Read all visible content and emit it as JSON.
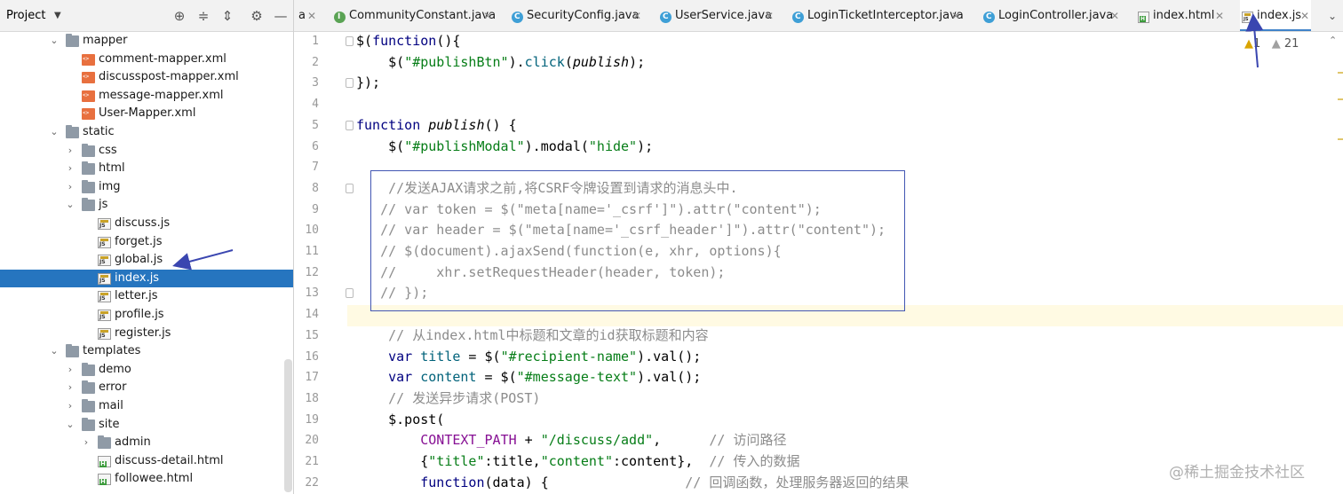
{
  "project_panel": {
    "title": "Project",
    "dropdown_icon": "chevron-down-icon",
    "toolbar_icons": [
      "locate-icon",
      "expand-all-icon",
      "collapse-all-icon",
      "gear-icon",
      "minimize-icon"
    ],
    "tree": [
      {
        "label": "mapper",
        "type": "folder",
        "depth": 0,
        "expanded": true
      },
      {
        "label": "comment-mapper.xml",
        "type": "xml",
        "depth": 1
      },
      {
        "label": "discusspost-mapper.xml",
        "type": "xml",
        "depth": 1
      },
      {
        "label": "message-mapper.xml",
        "type": "xml",
        "depth": 1
      },
      {
        "label": "User-Mapper.xml",
        "type": "xml",
        "depth": 1
      },
      {
        "label": "static",
        "type": "folder",
        "depth": 0,
        "expanded": true
      },
      {
        "label": "css",
        "type": "folder",
        "depth": 1,
        "expanded": false
      },
      {
        "label": "html",
        "type": "folder",
        "depth": 1,
        "expanded": false
      },
      {
        "label": "img",
        "type": "folder",
        "depth": 1,
        "expanded": false
      },
      {
        "label": "js",
        "type": "folder",
        "depth": 1,
        "expanded": true
      },
      {
        "label": "discuss.js",
        "type": "js",
        "depth": 2
      },
      {
        "label": "forget.js",
        "type": "js",
        "depth": 2
      },
      {
        "label": "global.js",
        "type": "js",
        "depth": 2
      },
      {
        "label": "index.js",
        "type": "js",
        "depth": 2,
        "selected": true
      },
      {
        "label": "letter.js",
        "type": "js",
        "depth": 2
      },
      {
        "label": "profile.js",
        "type": "js",
        "depth": 2
      },
      {
        "label": "register.js",
        "type": "js",
        "depth": 2
      },
      {
        "label": "templates",
        "type": "folder",
        "depth": 0,
        "expanded": true
      },
      {
        "label": "demo",
        "type": "folder",
        "depth": 1,
        "expanded": false
      },
      {
        "label": "error",
        "type": "folder",
        "depth": 1,
        "expanded": false
      },
      {
        "label": "mail",
        "type": "folder",
        "depth": 1,
        "expanded": false
      },
      {
        "label": "site",
        "type": "folder",
        "depth": 1,
        "expanded": true
      },
      {
        "label": "admin",
        "type": "folder",
        "depth": 2,
        "expanded": false
      },
      {
        "label": "discuss-detail.html",
        "type": "html",
        "depth": 2
      },
      {
        "label": "followee.html",
        "type": "html",
        "depth": 2
      }
    ]
  },
  "tabs": [
    {
      "label": "a",
      "icon": "none",
      "active": false
    },
    {
      "label": "CommunityConstant.java",
      "icon": "interface",
      "active": false
    },
    {
      "label": "SecurityConfig.java",
      "icon": "class",
      "active": false
    },
    {
      "label": "UserService.java",
      "icon": "class",
      "active": false
    },
    {
      "label": "LoginTicketInterceptor.java",
      "icon": "class",
      "active": false
    },
    {
      "label": "LoginController.java",
      "icon": "class",
      "active": false
    },
    {
      "label": "index.html",
      "icon": "html",
      "active": false
    },
    {
      "label": "index.js",
      "icon": "js",
      "active": true
    }
  ],
  "tab_close_icon": "close-icon",
  "tab_menu_icon": "chevron-down-icon",
  "inspection": {
    "warnings_a": "1",
    "warnings_b": "21"
  },
  "editor": {
    "current_line": 14,
    "lines": [
      {
        "n": 1,
        "html": "$(<span class='kw'>function</span>(){"
      },
      {
        "n": 2,
        "html": "    $(<span class='str'>\"#publishBtn\"</span>).<span class='fn'>click</span>(<span class='it'>publish</span>);"
      },
      {
        "n": 3,
        "html": "});"
      },
      {
        "n": 4,
        "html": ""
      },
      {
        "n": 5,
        "html": "<span class='kw'>function</span> <span class='it'>publish</span>() {"
      },
      {
        "n": 6,
        "html": "    $(<span class='str'>\"#publishModal\"</span>).modal(<span class='str'>\"hide\"</span>);"
      },
      {
        "n": 7,
        "html": ""
      },
      {
        "n": 8,
        "html": "<span class='gray'>    //发送AJAX请求之前,将CSRF令牌设置到请求的消息头中.</span>"
      },
      {
        "n": 9,
        "html": "<span class='gray'>   // var token = $(\"meta[name='_csrf']\").attr(\"content\");</span>"
      },
      {
        "n": 10,
        "html": "<span class='gray'>   // var header = $(\"meta[name='_csrf_header']\").attr(\"content\");</span>"
      },
      {
        "n": 11,
        "html": "<span class='gray'>   // $(document).ajaxSend(function(e, xhr, options){</span>"
      },
      {
        "n": 12,
        "html": "<span class='gray'>   //     xhr.setRequestHeader(header, token);</span>"
      },
      {
        "n": 13,
        "html": "<span class='gray'>   // });</span>"
      },
      {
        "n": 14,
        "html": ""
      },
      {
        "n": 15,
        "html": "<span class='gray'>    // 从index.html中标题和文章的id获取标题和内容</span>"
      },
      {
        "n": 16,
        "html": "    <span class='kw'>var</span> <span class='fn'>title</span> = $(<span class='str'>\"#recipient-name\"</span>).val();"
      },
      {
        "n": 17,
        "html": "    <span class='kw'>var</span> <span class='fn'>content</span> = $(<span class='str'>\"#message-text\"</span>).val();"
      },
      {
        "n": 18,
        "html": "<span class='gray'>    // 发送异步请求(POST)</span>"
      },
      {
        "n": 19,
        "html": "    $.post("
      },
      {
        "n": 20,
        "html": "        <span class='var'>CONTEXT_PATH</span> + <span class='str'>\"/discuss/add\"</span>,      <span class='gray'>// 访问路径</span>"
      },
      {
        "n": 21,
        "html": "        {<span class='str'>\"title\"</span>:title,<span class='str'>\"content\"</span>:content},  <span class='gray'>// 传入的数据</span>"
      },
      {
        "n": 22,
        "html": "        <span class='kw'>function</span>(data) {                 <span class='gray'>// 回调函数，处理服务器返回的结果</span>"
      }
    ]
  },
  "watermark": "@稀土掘金技术社区",
  "colors": {
    "selection": "#2675bf",
    "accent": "#4083c9",
    "arrow": "#3a46b0",
    "box": "#4256b3"
  }
}
